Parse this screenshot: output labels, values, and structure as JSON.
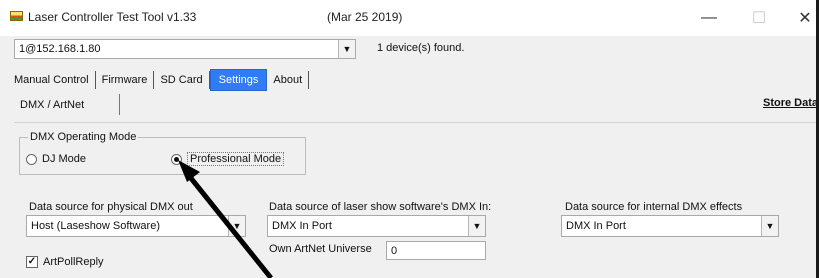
{
  "window": {
    "title": "Laser Controller Test Tool   v1.33",
    "date": "(Mar 25 2019)",
    "minimize_glyph": "—",
    "maximize_glyph": "☐",
    "close_glyph": "✕"
  },
  "device": {
    "selected": "1@152.168.1.80",
    "status": "1 device(s) found."
  },
  "tabs": [
    {
      "label": "Manual Control",
      "active": false
    },
    {
      "label": "Firmware",
      "active": false
    },
    {
      "label": "SD Card",
      "active": false
    },
    {
      "label": "Settings",
      "active": true
    },
    {
      "label": "About",
      "active": false
    }
  ],
  "settings": {
    "subtab": "DMX / ArtNet",
    "store_data": "Store Data",
    "dmx_mode": {
      "legend": "DMX Operating Mode",
      "options": [
        {
          "label": "DJ Mode",
          "selected": false
        },
        {
          "label": "Professional Mode",
          "selected": true
        }
      ]
    },
    "physical_source": {
      "label": "Data source for physical DMX out",
      "value": "Host (Laseshow Software)"
    },
    "software_source": {
      "label": "Data source of laser show software's DMX In:",
      "value": "DMX In Port"
    },
    "internal_source": {
      "label": "Data source for internal DMX effects",
      "value": "DMX In Port"
    },
    "artnet_universe": {
      "label": "Own ArtNet Universe",
      "value": "0"
    },
    "artpoll": {
      "label": "ArtPollReply",
      "checked": true
    }
  },
  "colors": {
    "active_tab": "#2f7cf6",
    "window_bg": "#f0f0f0",
    "annotation_arrow": "#000000"
  },
  "icons": {
    "app": "laser-app-icon",
    "combo": "chevron-down-icon"
  }
}
